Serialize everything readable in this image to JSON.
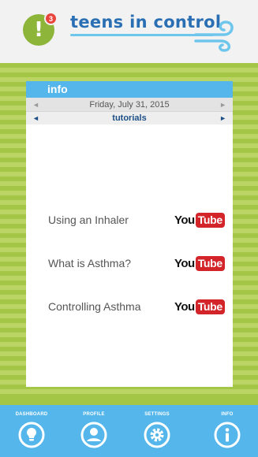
{
  "header": {
    "notification_count": "3",
    "logo_glyph": "!",
    "app_title": "teens in control"
  },
  "panel": {
    "title": "info",
    "date_row": {
      "prev_arrow": "◄",
      "label": "Friday, July 31, 2015",
      "next_arrow": "►"
    },
    "section_row": {
      "prev_arrow": "◄",
      "label": "tutorials",
      "next_arrow": "►"
    },
    "tutorials": [
      {
        "label": "Using an Inhaler",
        "logo_left": "You",
        "logo_right": "Tube"
      },
      {
        "label": "What is Asthma?",
        "logo_left": "You",
        "logo_right": "Tube"
      },
      {
        "label": "Controlling Asthma",
        "logo_left": "You",
        "logo_right": "Tube"
      }
    ]
  },
  "tabbar": {
    "tabs": [
      {
        "label": "DASHBOARD",
        "icon": "lightbulb-icon"
      },
      {
        "label": "PROFILE",
        "icon": "person-icon"
      },
      {
        "label": "SETTINGS",
        "icon": "gear-icon"
      },
      {
        "label": "INFO",
        "icon": "info-icon"
      }
    ]
  },
  "colors": {
    "accent_blue": "#54b6ea",
    "title_blue": "#2a6fb4",
    "green": "#a3c646",
    "green_light": "#bad563",
    "youtube_red": "#d3242a",
    "badge_red": "#e8453c"
  }
}
